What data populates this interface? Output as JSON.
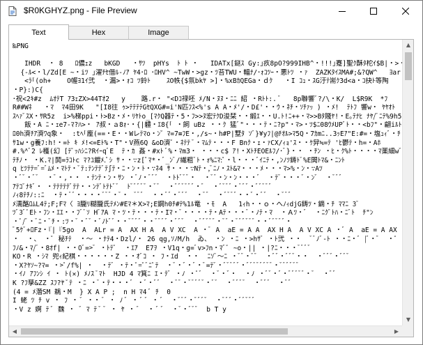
{
  "window": {
    "title": "$R0KGHYZ.png - File Preview",
    "minimize_icon": "minimize-icon",
    "maximize_icon": "maximize-icon",
    "close_icon": "close-icon"
  },
  "tabs": [
    {
      "label": "Text",
      "active": true
    },
    {
      "label": "Hex",
      "active": false
    },
    {
      "label": "Image",
      "active": false
    }
  ],
  "text_preview": {
    "lines": [
      "‰PNG",
      "",
      "   IHDR  ・ 8   ﾛ儂ｪz   bKGD   ・ｻﾂ  pHYs  ﾄ ﾄ ・   IDATx[鎹ｽ Gy:｣疚8pO?999IHB^・!!!｣蹇]聖ｸ酥ﾀ柁ｲ$B|・>・鐘・B・O` ・",
      "  {-ﾙ<・l/Zd[E ~・iﾂ ｣濯ﾁｾ借ﾙ-ﾉｱ ﾔ4･ﾛ ･ﾛHV^ ~TwW・>gz・ﾂ苔TWU・輻ﾅ/･ｫｺﾂｰ・悪ﾄﾂ ・ｧ  ZAZKﾀｲｽMA#;&?QW^   ﾖar ・2・ ｲﾃ",
      "   <ﾗ｢(oh+    O幄ﾖ1ｲ弐  ・漏>・ｫｺ ﾂ鈴ﾄ    ｽO帙{$氛bkﾔ >]・%xBｶQEGa・ｄｸ   ・I ｺｭ・ｽG汙ﾃ耑ｸ3d<a・ｺ抉ﾄ等陶    ・=ｪｾ褓ﾑ:濱U)ﾔﾔ",
      "・P}:)C{",
      "･祝<2ｷ#z  ﾑｵﾃT ｱ3ｪZX>44Tｵ2   y    路.r・ \"<Dｺ禄呸 ﾒ/N・ﾇﾇ・ﾆﾆ 紹 ・Rﾄﾄ:. ﾞ   8p聯響ﾞ?/\\・K/  L$R9K  *ﾌ",
      "R##Wﾈ   ・ﾏ  ﾏ4田9K   \"[I8往 ｩ>ﾃﾃﾃﾃGｾQXG#=i'N匹ﾌｽ<%'s A A・ﾒ'/・D£'・・ｳ・ﾈﾁ・ｿﾁｧｯ ) ・ﾒ!  ﾃﾄﾌ 響w・ ﾔﾔｵﾄ  韓Ｊ`ﾝﾆ",
      "ｽﾍｧﾞｽX・ｻR5z  i>%梯ppi・ﾄ>Bz・ﾒ・ﾘﾔﾄo_[ﾏｸQ器ﾃ・5・ﾌ>>ﾇ宏ﾃｸD浚栞・・緞ｴ・・U.ﾄ!ﾆ++・ﾏ>>Bﾀ賤ﾔ!・E｡ﾃﾅﾋ ﾅﾔ/ﾞﾆﾃ%9h500~w・",
      "   飯・A ﾆ・ｪe7-ﾏ?ﾊ>・ ｱ叔・ａ8ｫ･・{|軆・ｴ8{｢ ・飼 uBz ・・ｸ 猛ﾞ\"・・・ﾃ・ﾆ?p\"・ﾏ>・ﾂ$ﾆ08ｳﾒUPﾞﾄ・・<bﾌ\"・翩iﾙﾄ ﾍ・・ﾆ",
      "ﾛ0h濟ﾁｱ濟ﾜq象・  :tﾍ｢龐(==・E・・Wレﾃﾏo・ﾝ゛ﾏ=7≡ﾌE・,/s~・h#P|墅ﾀ ｿﾞ}¥yﾌ|@ﾁｵﾙ>ﾏ5Q・7ｶmﾆ..3ｯEｱ\"E:#=・塩ｭｨﾞ・ﾁ",
      "ｻ1w・g養ﾌ:h!・=ﾄ ｷ ﾒ!<=Eﾄ%・T\"・V燕6Q &oD濟ﾟ・ﾈﾃﾃ ﾞ・ﾏﾑﾃ・・・F Bnｸ・ｪ・ｧCX/ｨｮ'ｽ・・ｹ舁≒=ﾃ 'ﾋ鬱ﾃ・h=・Aﾎ",
      "#.%^ﾞ2 ﾚ穫(幻 [ﾃﾟｯﾊｼﾆ?RｲｰqﾞE  ﾃ・ｶ 姦・#xﾄ ﾞ%・ﾏm3・ ・・・c$ ｱ!・XﾄﾁEOEﾙﾌ/･ﾞ}・・ ・ﾁﾝ ・ﾋ・ｸ%ﾄ・・・・ﾏ薬細wﾞ/ﾆﾔ",
      "ﾃﾁﾉ・ ・K.ﾏ|鬨=ﾗｺﾄc ﾏ?ﾕ鍍ﾒ.ﾟｼ ｻ・・∵z[ﾟﾏ*・ﾞ_ﾝﾞ/繊粗ﾞﾄ・ｫ%ﾆﾏ:ﾟ・l・・・ﾞｲﾆﾃ・,ﾝﾉﾂ鋳ﾄﾞ%E閧ﾄﾏ&・ﾆﾝﾄ",
      "q ﾋﾂﾃﾃ=ﾞ=ﾞﾑﾒ・ﾏﾄﾃ・ﾞﾃ:ﾃﾝﾃﾃﾞﾃ∫ﾃ・ﾆ・ﾝ・ﾄ・∵ﾈ4 ｻ・・・∵Nﾃ・,ﾞﾆﾉ・ｽﾄ&ﾏ・・・ﾒ・・・ﾏ>%・ﾝ・∵Aﾂ",
      "・ﾞﾞ・ﾞﾞ  ・ﾞ・,・・ ・ﾃﾝﾃ・ﾝ・ｻﾝ ・ﾞﾉ・ﾞﾞﾞ  ・ﾄﾄﾞﾞﾞ・  ・ﾞﾞ・ﾝ・ﾝ・・・ﾞ  ・ﾃﾞ・・・ﾞ・ﾝﾞ  ・ﾞﾞﾞ",
      "ｱﾃｺﾞﾅｷﾞ・ ・ﾃﾃﾃﾃﾃﾞﾃﾃ・・ﾝﾃﾞﾄﾃﾄﾞﾞ  ﾄﾞﾞﾞﾞﾞ・ﾞﾞ  ・ﾞﾞﾞﾞﾞﾞ・ﾞ  ・ﾞﾞﾞﾞ・ﾞﾞﾞ・ﾞﾞﾞﾞﾞ",
      "ﾉｨ8ﾃﾁﾉ::ﾆ  ・ﾃ・ﾞﾞ・・・・ﾞﾞﾞ・ﾞ・  ﾞﾞﾞ  ・・ﾞﾞ・ﾞﾞﾞ  ・ﾞﾞ  ・ﾞﾞﾞﾞ・・ﾞ・ﾞﾞ  ・ﾞﾞﾞ",
      "ﾒ濡酪ﾛﾑL4ﾃ;F;Fﾏ〈 ﾖ朧ﾘ糊朧氏ﾃﾒﾝ#Eﾏ＊Ⅹ>ﾏ;E鋼h0ﾁ#ﾃ%1ﾙ竜 ・ﾓ  A   1ｨh・・ｏ・へﾉｨdjG鋳ﾂ・鏑・ﾁ ﾏﾏﾆ 3ﾞ",
      "ﾂﾞ3ﾞﾟEﾄ・ﾌﾝ・ｴｴ・・ﾌﾞﾞｿ HﾞｱA ﾏ・ﾂ・ﾃ・・・ﾃ・Iﾏ・ﾞ・・・・ﾃ・Aﾃ・・・ﾞ・ﾉﾃ・ﾏ  ・Ａﾂ・ﾞ  ・ﾆｸﾞﾄﾊ・ﾆﾞﾄ  ﾁ\"ﾝ",
      "・ﾟ/ﾞ・ﾞﾆ・ﾞﾁ・:ﾂ・ﾞ・ﾞﾞ・ﾞﾉﾄﾞﾞ・・ﾞﾞﾞﾞ・・ﾞﾞﾞﾞ・ﾞﾞﾞ  ・ﾞﾞﾞﾞﾞ・ﾞﾞ・ﾞﾞﾞﾞﾞﾞ・・ﾞﾞﾞﾞﾞ・",
      "ﾞ5ｹﾞ+ﾛFz・『|『5go  A  ALr = A  AX H A  A V XC  A ・ﾞ A  aE = A A  AX H A  A V XC A ・ﾞ A  aE = A AX  ・=0ﾄ」",
      "・  ・、 ・ﾟ 秘ﾁﾃ  ・〜 ・ﾅﾃ4・Dzl/・ 26 qg,ｿﾉM/h  ゐ、 ・ﾝ ・ﾆ ・>hｻﾞ ・ﾄ弐 ・・  ﾞﾞﾉﾞ-ﾄ ・・ﾆ・ﾞ |ﾞ・ﾞ  ・ﾟ  =ﾇ",
      "ﾌﾉ&・ﾏ/ﾞ・8ｵf| ・・0ﾞ=>ﾞ ・ﾄﾃﾟ  ・ｴｱ  E7ｦ ・V1q・g=ﾞv>ﾌn・ﾏﾞﾟ ~o・|| ・|?ﾆ・・・ﾞﾞﾞﾞ",
      "KO・R ・ｼﾏ 兜ｨ紀棋・・・・・・Z ・・ｵﾞｺ ・ ﾌ・ｴd  ・・  ﾆｿﾞ〜ﾆ ・ﾞﾞ・ﾞﾞ  ・ﾞﾞ・ﾞﾞﾞ・・  ・ﾞﾞﾞ・ﾞﾞﾞ",
      "・X?ﾔｿ~?ﾏ= ・>ﾟ/f%| ・  ・ﾃﾞ ・ﾃ・ﾟ=ﾟﾞﾆﾟﾃ  ・ﾞ・ﾞ・ﾞ・ﾞ=ﾃﾞ・ﾞﾞﾞﾞﾞ・ﾞﾞﾞﾞﾞﾞﾞﾞ・ﾞﾞﾞﾞﾞﾞ",
      "・ｲﾉ ｱﾌﾝｼ ｲ ・ ﾄ(✕) ﾒﾉｽ ﾞﾏﾄ  HJD 4 ﾏ箕ﾆ ｴ・ﾃﾞ ・ﾉ ・ﾟﾞ  ・ﾞ・ﾞ・  ・ﾉ ・ﾞﾞ・ﾞ・ﾞﾞﾞﾞﾞ・ﾞ  ・ﾞﾞ",
      "K ?ﾌ孳&ZZ ｽﾌ?ﾔ ﾟﾃ ・ﾆ ・ﾞ・ﾃ・・・ﾞ ・ﾞ・ﾞﾞ  ・ﾞﾞ・ﾞﾞﾞﾞﾞ・ﾞﾞ  ・ﾞﾞﾞﾞ  ・ﾞﾞﾞ  ・ﾞﾞ",
      "(4 = ﾒ濳SM 鵜・M  } X A P ;  n H ﾏ4 ﾞ ﾁ  0",
      "I 蛯 ﾂ ﾁ v ・ ﾌ ・ ﾞ ・・ ﾞ ・ ﾉ ﾞ ・ ﾞ ﾞ ・ ﾞ  ・ﾞﾞﾞ・ﾞﾞﾞﾞ  ・ﾞﾞﾞ・ﾞﾞﾞﾞﾞ",
      "・V z 婀 ﾃ ﾞ 魏 ・ ﾞ ﾏ ﾃ ﾞ ﾞ ・ ﾔ ・ ﾞ  ・ ﾞ ﾞ  ・ﾞ・ﾞﾞﾞ  b T y"
    ]
  }
}
